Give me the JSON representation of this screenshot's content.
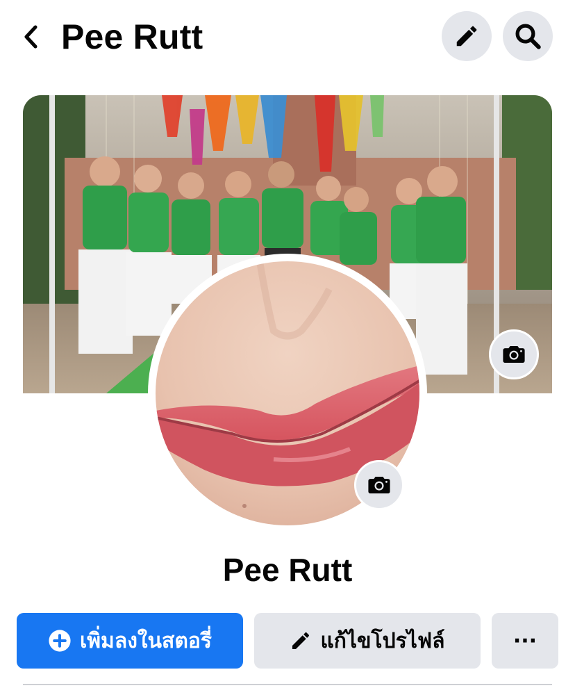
{
  "header": {
    "title": "Pee Rutt",
    "back_icon": "chevron-left-icon",
    "edit_icon": "pencil-icon",
    "search_icon": "search-icon"
  },
  "cover": {
    "camera_icon": "camera-icon"
  },
  "profile": {
    "name": "Pee Rutt",
    "camera_icon": "camera-icon"
  },
  "actions": {
    "add_story_label": "เพิ่มลงในสตอรี่",
    "edit_profile_label": "แก้ไขโปรไฟล์",
    "more_label": "···"
  },
  "colors": {
    "primary": "#1877f2",
    "button_gray": "#e4e6eb",
    "text": "#050505"
  }
}
